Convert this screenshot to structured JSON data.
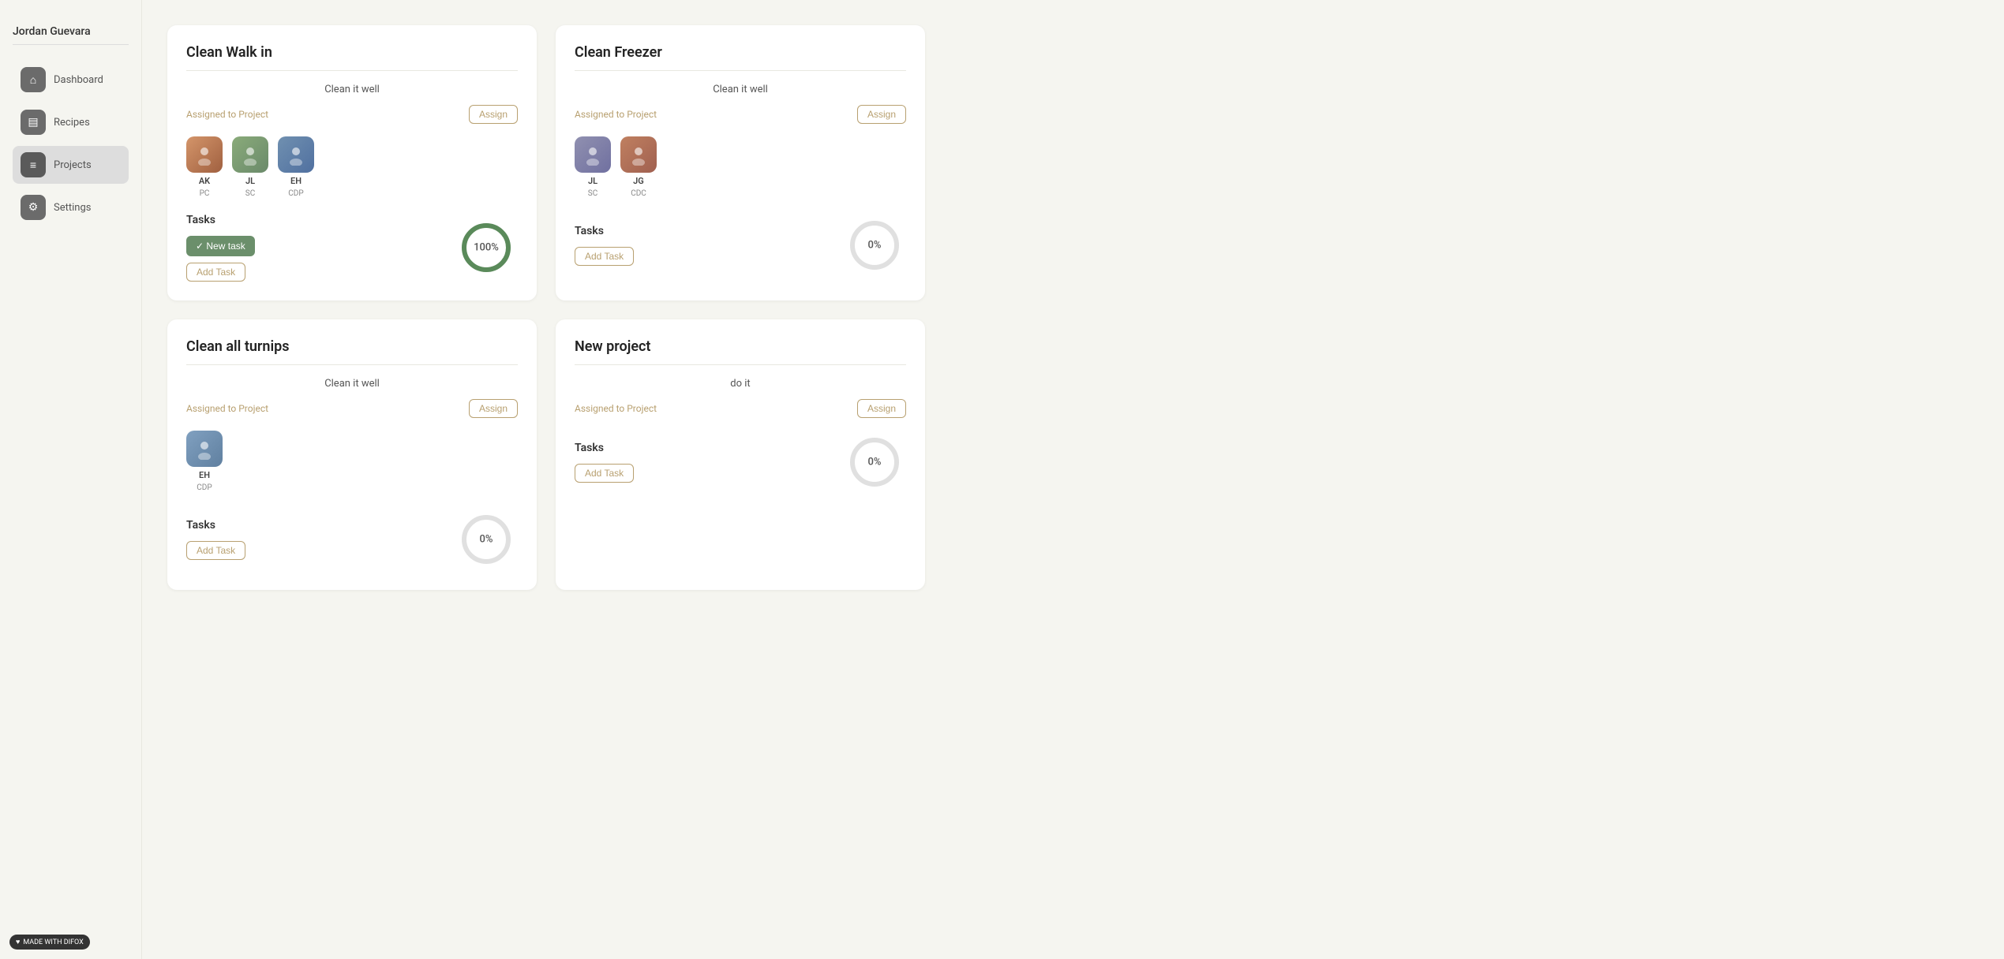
{
  "sidebar": {
    "user": "Jordan Guevara",
    "items": [
      {
        "id": "dashboard",
        "label": "Dashboard",
        "icon": "⌂"
      },
      {
        "id": "recipes",
        "label": "Recipes",
        "icon": "▤"
      },
      {
        "id": "projects",
        "label": "Projects",
        "icon": "≡",
        "active": true
      },
      {
        "id": "settings",
        "label": "Settings",
        "icon": "⚙"
      }
    ]
  },
  "projects": [
    {
      "id": "clean-walk-in",
      "title": "Clean Walk in",
      "description": "Clean it well",
      "assigned_label": "Assigned to Project",
      "assign_btn": "Assign",
      "assignees": [
        {
          "initials": "AK",
          "role": "PC",
          "color": "photo-ak"
        },
        {
          "initials": "JL",
          "role": "SC",
          "color": "photo-jl"
        },
        {
          "initials": "EH",
          "role": "CDP",
          "color": "photo-eh-1"
        }
      ],
      "tasks_label": "Tasks",
      "new_task_label": "✓ New task",
      "add_task_label": "Add Task",
      "progress": 100,
      "progress_label": "100%",
      "has_new_task": true
    },
    {
      "id": "clean-freezer",
      "title": "Clean Freezer",
      "description": "Clean it well",
      "assigned_label": "Assigned to Project",
      "assign_btn": "Assign",
      "assignees": [
        {
          "initials": "JL",
          "role": "SC",
          "color": "photo-jl2"
        },
        {
          "initials": "JG",
          "role": "CDC",
          "color": "photo-jg"
        }
      ],
      "tasks_label": "Tasks",
      "new_task_label": null,
      "add_task_label": "Add Task",
      "progress": 0,
      "progress_label": "0%",
      "has_new_task": false
    },
    {
      "id": "clean-all-turnips",
      "title": "Clean all turnips",
      "description": "Clean it well",
      "assigned_label": "Assigned to Project",
      "assign_btn": "Assign",
      "assignees": [
        {
          "initials": "EH",
          "role": "CDP",
          "color": "photo-eh-2"
        }
      ],
      "tasks_label": "Tasks",
      "new_task_label": null,
      "add_task_label": "Add Task",
      "progress": 0,
      "progress_label": "0%",
      "has_new_task": false
    },
    {
      "id": "new-project",
      "title": "New project",
      "description": "do it",
      "assigned_label": "Assigned to Project",
      "assign_btn": "Assign",
      "assignees": [],
      "tasks_label": "Tasks",
      "new_task_label": null,
      "add_task_label": "Add Task",
      "progress": 0,
      "progress_label": "0%",
      "has_new_task": false
    }
  ],
  "made_with": "MADE WITH DIFOX"
}
